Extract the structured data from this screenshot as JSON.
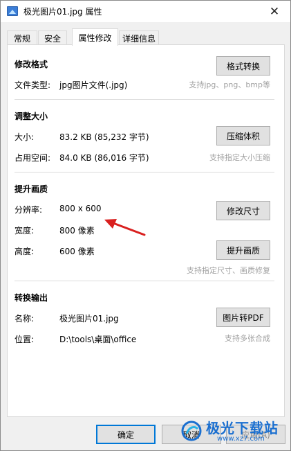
{
  "window": {
    "title": "极光图片01.jpg 属性",
    "close_glyph": "✕"
  },
  "tabs": [
    {
      "label": "常规",
      "active": false
    },
    {
      "label": "安全",
      "active": false
    },
    {
      "label": "属性修改",
      "active": true
    },
    {
      "label": "详细信息",
      "active": false
    }
  ],
  "format": {
    "title": "修改格式",
    "type_label": "文件类型:",
    "type_value": "jpg图片文件(.jpg)",
    "button": "格式转换",
    "hint": "支持jpg、png、bmp等"
  },
  "resize": {
    "title": "调整大小",
    "size_label": "大小:",
    "size_value": "83.2 KB (85,232 字节)",
    "disk_label": "占用空间:",
    "disk_value": "84.0 KB (86,016 字节)",
    "button": "压缩体积",
    "hint": "支持指定大小压缩"
  },
  "quality": {
    "title": "提升画质",
    "resolution_label": "分辨率:",
    "resolution_value": "800 x 600",
    "resize_button": "修改尺寸",
    "width_label": "宽度:",
    "width_value": "800 像素",
    "height_label": "高度:",
    "height_value": "600 像素",
    "enhance_button": "提升画质",
    "hint": "支持指定尺寸、画质修复"
  },
  "output": {
    "title": "转换输出",
    "name_label": "名称:",
    "name_value": "极光图片01.jpg",
    "location_label": "位置:",
    "location_value": "D:\\tools\\桌面\\office",
    "button": "图片转PDF",
    "hint": "支持多张合成"
  },
  "footer": {
    "ok": "确定",
    "cancel": "取消",
    "apply": "应用(A)"
  },
  "watermark": {
    "text": "极光下载站",
    "url": "www.xz7.com"
  },
  "colors": {
    "accent": "#0078d7",
    "arrow": "#d9201f",
    "watermark": "#1a6fd0"
  }
}
